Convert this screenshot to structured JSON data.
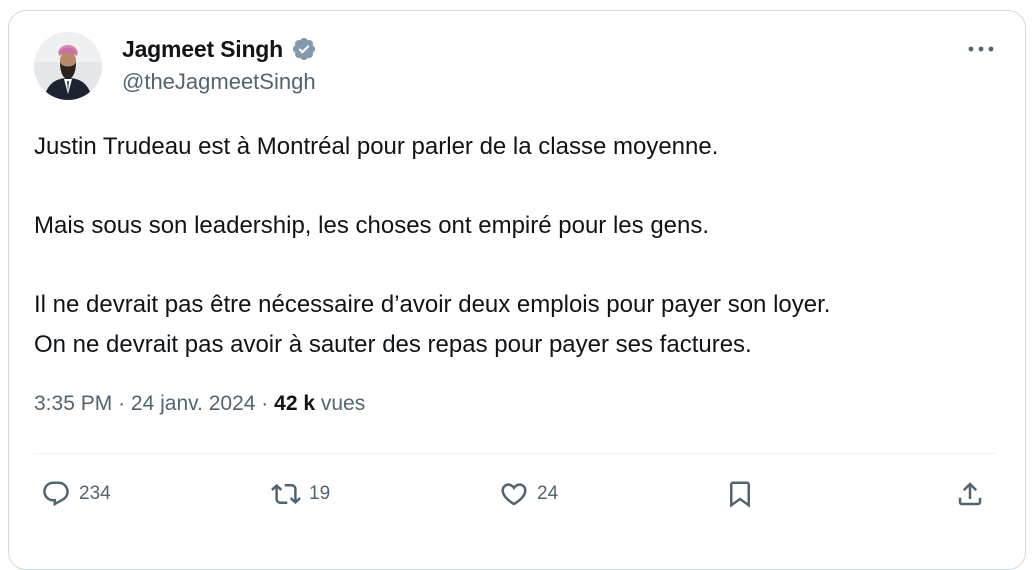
{
  "author": {
    "display_name": "Jagmeet Singh",
    "handle": "@theJagmeetSingh",
    "verified": true
  },
  "tweet": {
    "paragraphs": [
      "Justin Trudeau est à Montréal pour parler de la classe moyenne.",
      "Mais sous son leadership, les choses ont empiré pour les gens.",
      "Il ne devrait pas être nécessaire d’avoir deux emplois pour payer son loyer.",
      "On ne devrait pas avoir à sauter des repas pour payer ses factures."
    ]
  },
  "meta": {
    "time": "3:35 PM",
    "separator": "·",
    "date": "24 janv. 2024",
    "views_count": "42 k",
    "views_label": "vues"
  },
  "actions": {
    "replies": "234",
    "reposts": "19",
    "likes": "24"
  },
  "icons": {
    "more": "more-horizontal-icon",
    "verified": "verified-badge-icon",
    "reply": "reply-icon",
    "repost": "repost-icon",
    "like": "heart-icon",
    "bookmark": "bookmark-icon",
    "share": "share-icon"
  },
  "colors": {
    "text_primary": "#0f1419",
    "text_secondary": "#536471",
    "border": "#cfd9de",
    "verified_badge": "#829aab"
  }
}
